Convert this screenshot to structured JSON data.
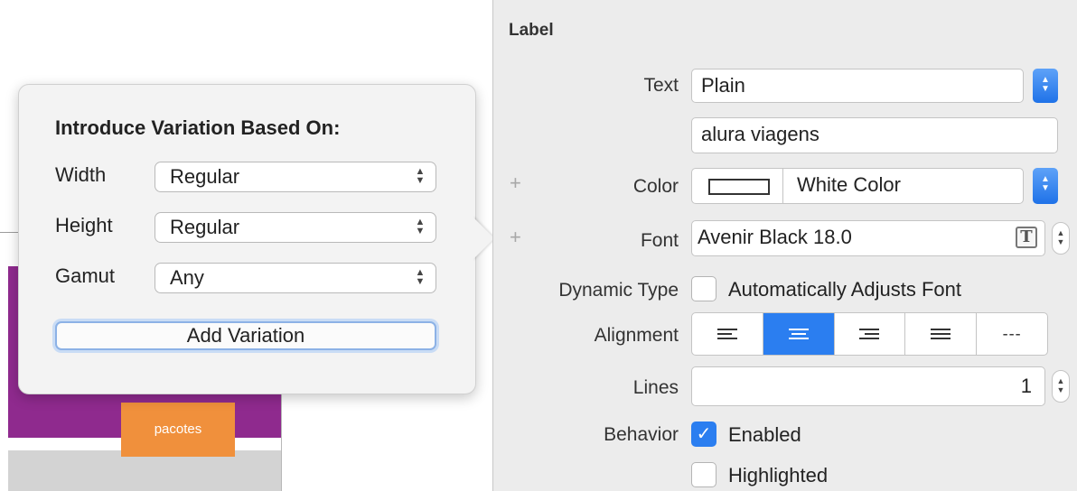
{
  "canvas": {
    "tab_label": "pacotes"
  },
  "popover": {
    "title": "Introduce Variation Based On:",
    "rows": [
      {
        "label": "Width",
        "value": "Regular"
      },
      {
        "label": "Height",
        "value": "Regular"
      },
      {
        "label": "Gamut",
        "value": "Any"
      }
    ],
    "add_button": "Add Variation"
  },
  "inspector": {
    "section": "Label",
    "text": {
      "label": "Text",
      "value": "Plain",
      "content": "alura viagens"
    },
    "color": {
      "label": "Color",
      "value": "White Color"
    },
    "font": {
      "label": "Font",
      "value": "Avenir Black 18.0"
    },
    "dynamic_type": {
      "label": "Dynamic Type",
      "option": "Automatically Adjusts Font",
      "checked": false
    },
    "alignment": {
      "label": "Alignment",
      "options": [
        "left",
        "center",
        "right",
        "justified",
        "natural"
      ],
      "selected": "center",
      "natural_glyph": "---"
    },
    "lines": {
      "label": "Lines",
      "value": "1"
    },
    "behavior": {
      "label": "Behavior",
      "enabled": {
        "label": "Enabled",
        "checked": true
      },
      "highlighted": {
        "label": "Highlighted",
        "checked": false
      }
    }
  },
  "icons": {
    "plus": "+",
    "check": "✓",
    "font_picker": "T"
  },
  "colors": {
    "accent": "#2b7ef0",
    "purple": "#8f2a8e",
    "orange": "#f0903c"
  }
}
